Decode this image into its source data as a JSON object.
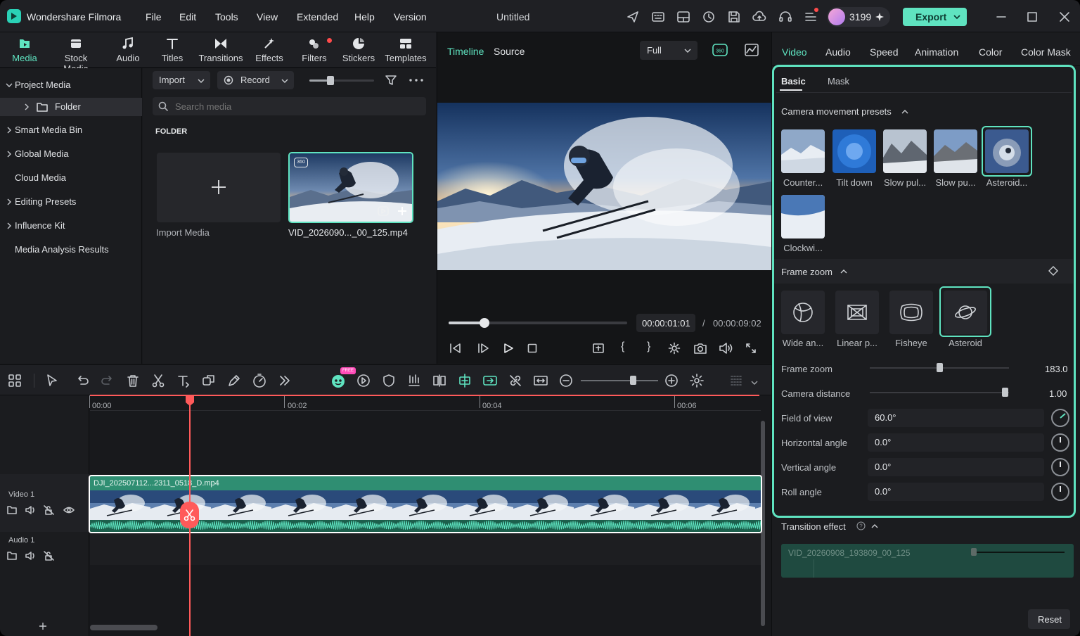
{
  "app": {
    "name": "Wondershare Filmora",
    "doc_title": "Untitled",
    "credits": "3199",
    "export_label": "Export"
  },
  "menu": [
    "File",
    "Edit",
    "Tools",
    "View",
    "Extended",
    "Help",
    "Version"
  ],
  "media_tabs": [
    {
      "label": "Media",
      "icon": "media-icon"
    },
    {
      "label": "Stock Media",
      "icon": "stock-media-icon"
    },
    {
      "label": "Audio",
      "icon": "audio-icon"
    },
    {
      "label": "Titles",
      "icon": "titles-icon"
    },
    {
      "label": "Transitions",
      "icon": "transitions-icon"
    },
    {
      "label": "Effects",
      "icon": "effects-icon"
    },
    {
      "label": "Filters",
      "icon": "filters-icon"
    },
    {
      "label": "Stickers",
      "icon": "stickers-icon"
    },
    {
      "label": "Templates",
      "icon": "templates-icon"
    }
  ],
  "tree": [
    "Project Media",
    "Folder",
    "Smart Media Bin",
    "Global Media",
    "Cloud Media",
    "Editing Presets",
    "Influence Kit",
    "Media Analysis Results"
  ],
  "media": {
    "import_label": "Import",
    "record_label": "Record",
    "search_placeholder": "Search media",
    "section": "FOLDER",
    "import_media": "Import Media",
    "clip_name": "VID_2026090..._00_125.mp4",
    "badge_360": "360"
  },
  "preview": {
    "tab_timeline": "Timeline",
    "tab_source": "Source",
    "quality": "Full",
    "current_time": "00:00:01:01",
    "separator": "/",
    "total_time": "00:00:09:02",
    "progress": 0.2
  },
  "rpanel": {
    "tabs": [
      "Video",
      "Audio",
      "Speed",
      "Animation",
      "Color",
      "Color Mask"
    ],
    "subtabs": [
      "Basic",
      "Mask"
    ],
    "presets_title": "Camera movement presets",
    "presets": [
      "Counter...",
      "Tilt down",
      "Slow pul...",
      "Slow pu...",
      "Asteroid...",
      "Clockwi..."
    ],
    "frame_zoom_title": "Frame zoom",
    "zoom_types": [
      "Wide an...",
      "Linear p...",
      "Fisheye",
      "Asteroid"
    ],
    "frame_zoom_label": "Frame zoom",
    "frame_zoom_value": "183.0",
    "frame_zoom_fraction": 0.5,
    "camera_distance_label": "Camera distance",
    "camera_distance_value": "1.00",
    "camera_distance_fraction": 0.97,
    "fov_label": "Field of view",
    "fov_value": "60.0°",
    "h_angle_label": "Horizontal angle",
    "h_angle_value": "0.0°",
    "v_angle_label": "Vertical angle",
    "v_angle_value": "0.0°",
    "roll_label": "Roll angle",
    "roll_value": "0.0°",
    "transition_title": "Transition effect",
    "transition_clip": "VID_20260908_193809_00_125",
    "reset_label": "Reset"
  },
  "timeline": {
    "ruler": [
      "00:00",
      "00:02",
      "00:04",
      "00:06"
    ],
    "video_track": "Video 1",
    "audio_track": "Audio 1",
    "clip_name": "DJI_202507112...2311_0518_D.mp4",
    "free_badge": "FREE"
  },
  "colors": {
    "accent": "#5fe3c0",
    "playhead": "#ff5a5a",
    "clip": "#2f8e72"
  }
}
